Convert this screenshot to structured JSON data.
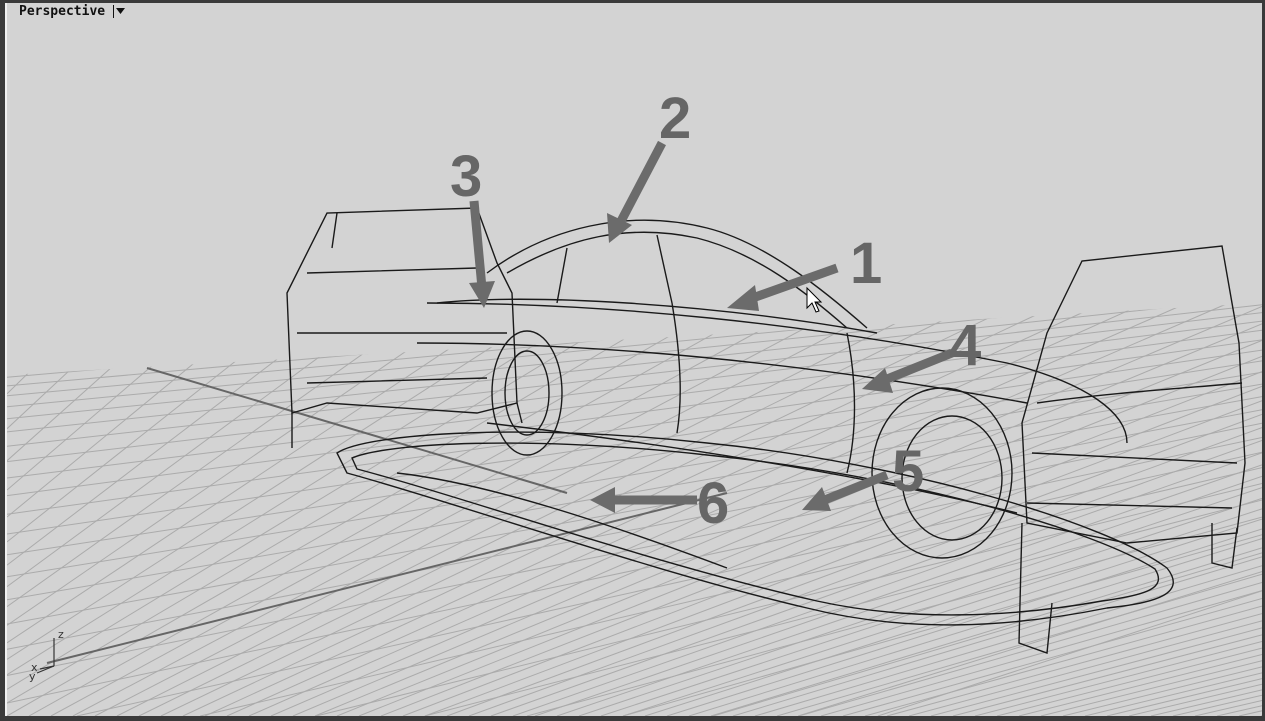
{
  "viewport": {
    "title": "Perspective",
    "menu_icon": "triangle-down-icon"
  },
  "axes": {
    "x": "x",
    "y": "y",
    "z": "z"
  },
  "callouts": [
    "1",
    "2",
    "3",
    "4",
    "5",
    "6"
  ],
  "colors": {
    "background": "#d3d3d3",
    "grid": "#a9a9a9",
    "wire": "#1a1a1a",
    "arrow": "#6b6b6b"
  }
}
